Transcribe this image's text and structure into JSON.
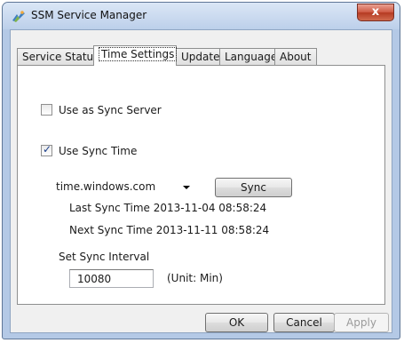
{
  "window": {
    "title": "SSM Service Manager",
    "close_label": "x"
  },
  "tabs": [
    {
      "label": "Service Status",
      "active": false
    },
    {
      "label": "Time Settings",
      "active": true
    },
    {
      "label": "Update",
      "active": false
    },
    {
      "label": "Language",
      "active": false
    },
    {
      "label": "About",
      "active": false
    }
  ],
  "time_settings": {
    "use_as_sync_server": {
      "label": "Use as Sync Server",
      "checked": false
    },
    "use_sync_time": {
      "label": "Use Sync Time",
      "checked": true,
      "mark": "✓"
    },
    "server_select": {
      "value": "time.windows.com"
    },
    "sync_button": "Sync",
    "last_sync": "Last Sync Time 2013-11-04 08:58:24",
    "next_sync": "Next Sync Time 2013-11-11 08:58:24",
    "interval_label": "Set Sync Interval",
    "interval_value": "10080",
    "interval_unit": "(Unit: Min)"
  },
  "footer": {
    "ok": "OK",
    "cancel": "Cancel",
    "apply": "Apply",
    "apply_enabled": false
  },
  "colors": {
    "window_frame": "#b4c9e6",
    "close_button": "#c9462c",
    "check_mark": "#1c3f8a"
  }
}
